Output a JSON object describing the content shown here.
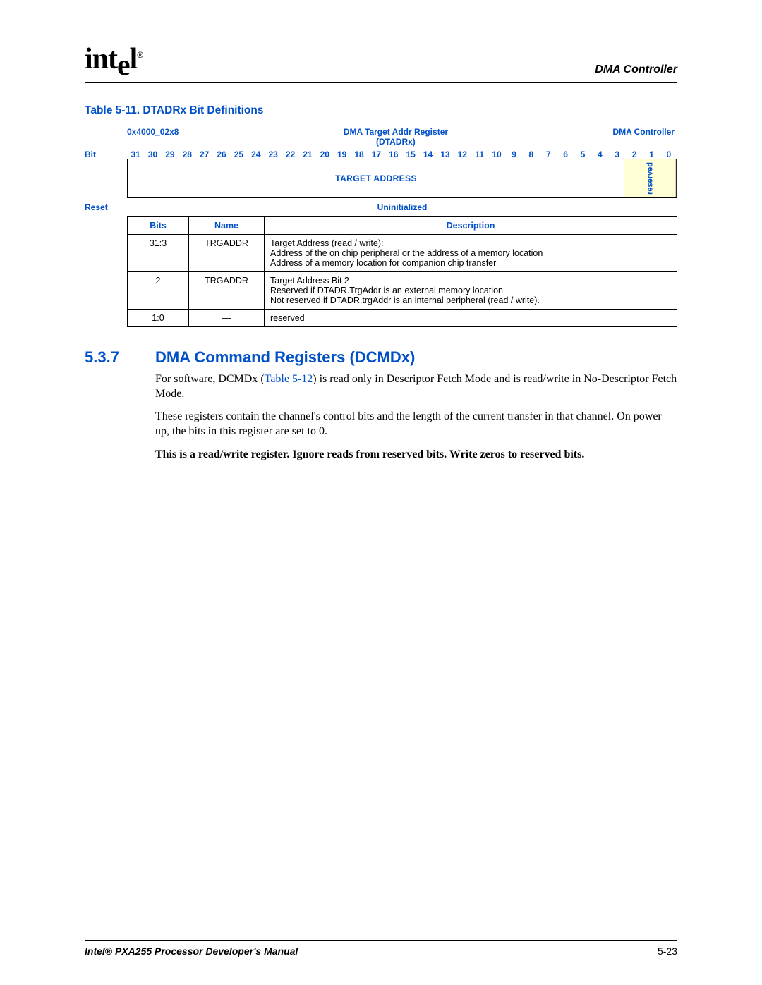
{
  "header": {
    "logo_text": "intel",
    "reg_mark": "®",
    "chapter": "DMA Controller"
  },
  "table": {
    "caption": "Table 5-11. DTADRx Bit Definitions",
    "addr": "0x4000_02x8",
    "regname_line1": "DMA Target Addr Register",
    "regname_line2": "(DTADRx)",
    "domain": "DMA Controller",
    "bit_label": "Bit",
    "bits": [
      "31",
      "30",
      "29",
      "28",
      "27",
      "26",
      "25",
      "24",
      "23",
      "22",
      "21",
      "20",
      "19",
      "18",
      "17",
      "16",
      "15",
      "14",
      "13",
      "12",
      "11",
      "10",
      "9",
      "8",
      "7",
      "6",
      "5",
      "4",
      "3",
      "2",
      "1",
      "0"
    ],
    "field_target": "TARGET ADDRESS",
    "field_reserved": "reserved",
    "reset_label": "Reset",
    "reset_value": "Uninitialized",
    "cols": {
      "bits": "Bits",
      "name": "Name",
      "desc": "Description"
    },
    "rows": [
      {
        "bits": "31:3",
        "name": "TRGADDR",
        "desc_l1": "Target Address (read / write):",
        "desc_l2": "Address of the on chip peripheral or the address of a memory location",
        "desc_l3": "Address of a memory location for companion chip transfer"
      },
      {
        "bits": "2",
        "name": "TRGADDR",
        "desc_l1": "Target Address Bit 2",
        "desc_l2": "Reserved if DTADR.TrgAddr is an external memory location",
        "desc_l3": "Not reserved if DTADR.trgAddr is an internal peripheral (read / write)."
      },
      {
        "bits": "1:0",
        "name": "—",
        "desc_l1": "reserved",
        "desc_l2": "",
        "desc_l3": ""
      }
    ]
  },
  "section": {
    "num": "5.3.7",
    "title": "DMA Command Registers (DCMDx)",
    "p1_a": "For software, DCMDx (",
    "p1_link": "Table 5-12",
    "p1_b": ") is read only in Descriptor Fetch Mode and is read/write in No-Descriptor Fetch Mode.",
    "p2": "These registers contain the channel's control bits and the length of the current transfer in that channel. On power up, the bits in this register are set to 0.",
    "p3": "This is a read/write register. Ignore reads from reserved bits. Write zeros to reserved bits."
  },
  "footer": {
    "manual": "Intel® PXA255 Processor Developer's Manual",
    "page": "5-23"
  }
}
